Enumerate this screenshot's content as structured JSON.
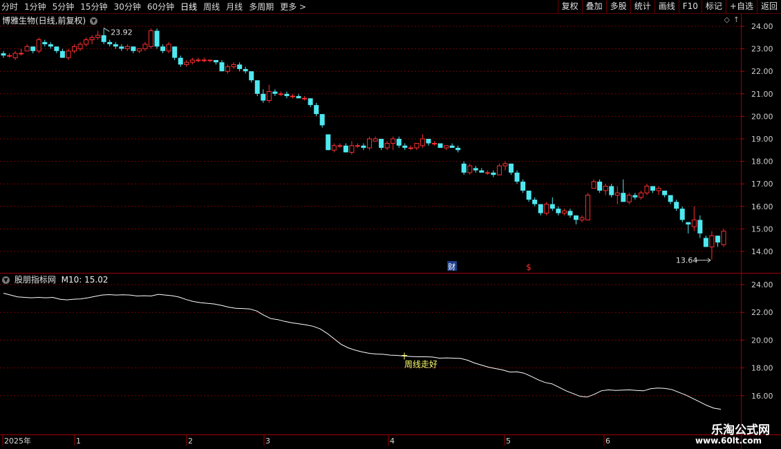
{
  "toolbar": {
    "periods": [
      "分时",
      "1分钟",
      "5分钟",
      "15分钟",
      "30分钟",
      "60分钟",
      "日线",
      "周线",
      "月线",
      "多周期",
      "更多 >"
    ],
    "active_period": "日线",
    "right_buttons": [
      "复权",
      "叠加",
      "多股",
      "统计",
      "画线",
      "F10",
      "标记",
      "+自选",
      "返回"
    ]
  },
  "main_panel": {
    "title": "博雅生物(日线,前复权)",
    "max_label": "23.92",
    "min_label": "13.64",
    "event_cai": "财",
    "event_dollar": "$"
  },
  "indicator_panel": {
    "name": "股朋指标网",
    "ma_label": "M10: 15.02",
    "annotation": "周线走好"
  },
  "x_axis": {
    "labels": [
      "2025年",
      "1",
      "2",
      "3",
      "4",
      "5",
      "6"
    ]
  },
  "watermark": {
    "line1": "乐淘公式网",
    "line2": "www.60lt.com"
  },
  "colors": {
    "up": "#ff3030",
    "down": "#4fe8f0",
    "grid": "#7a0000",
    "ma": "#ffffff",
    "annotation": "#ffff70"
  },
  "chart_data": [
    {
      "type": "candlestick",
      "title": "博雅生物(日线,前复权)",
      "ylim": [
        13.3,
        24.4
      ],
      "yticks": [
        14.0,
        15.0,
        16.0,
        17.0,
        18.0,
        19.0,
        20.0,
        21.0,
        22.0,
        23.0,
        24.0
      ],
      "candles": [
        [
          22.8,
          22.9,
          22.6,
          22.7
        ],
        [
          22.7,
          22.8,
          22.6,
          22.7
        ],
        [
          22.6,
          22.9,
          22.5,
          22.8
        ],
        [
          22.8,
          23.0,
          22.7,
          22.8
        ],
        [
          22.9,
          23.2,
          22.9,
          23.1
        ],
        [
          23.1,
          23.1,
          22.8,
          22.9
        ],
        [
          22.9,
          23.5,
          22.8,
          23.4
        ],
        [
          23.3,
          23.4,
          23.1,
          23.2
        ],
        [
          23.2,
          23.3,
          23.0,
          23.1
        ],
        [
          23.1,
          23.1,
          22.8,
          22.9
        ],
        [
          22.9,
          23.0,
          22.6,
          22.6
        ],
        [
          22.6,
          23.0,
          22.5,
          22.9
        ],
        [
          22.9,
          23.2,
          22.8,
          23.1
        ],
        [
          23.0,
          23.3,
          22.9,
          23.2
        ],
        [
          23.2,
          23.5,
          23.1,
          23.4
        ],
        [
          23.4,
          23.6,
          23.2,
          23.5
        ],
        [
          23.5,
          23.8,
          23.4,
          23.6
        ],
        [
          23.6,
          23.92,
          23.2,
          23.3
        ],
        [
          23.3,
          23.4,
          23.1,
          23.2
        ],
        [
          23.2,
          23.3,
          23.0,
          23.1
        ],
        [
          23.1,
          23.2,
          22.9,
          23.0
        ],
        [
          23.0,
          23.2,
          22.9,
          23.1
        ],
        [
          23.1,
          23.1,
          22.8,
          22.9
        ],
        [
          22.9,
          23.0,
          22.8,
          23.0
        ],
        [
          23.0,
          23.3,
          22.9,
          23.2
        ],
        [
          23.1,
          23.9,
          23.0,
          23.8
        ],
        [
          23.8,
          23.9,
          23.0,
          23.1
        ],
        [
          23.1,
          23.2,
          22.8,
          22.9
        ],
        [
          22.9,
          23.3,
          22.8,
          23.2
        ],
        [
          23.1,
          23.1,
          22.5,
          22.6
        ],
        [
          22.6,
          22.7,
          22.2,
          22.3
        ],
        [
          22.3,
          22.5,
          22.2,
          22.4
        ],
        [
          22.4,
          22.6,
          22.3,
          22.5
        ],
        [
          22.5,
          22.6,
          22.4,
          22.5
        ],
        [
          22.5,
          22.6,
          22.4,
          22.5
        ],
        [
          22.5,
          22.5,
          22.4,
          22.5
        ],
        [
          22.5,
          22.5,
          22.3,
          22.4
        ],
        [
          22.4,
          22.5,
          22.0,
          22.0
        ],
        [
          22.0,
          22.3,
          21.9,
          22.2
        ],
        [
          22.2,
          22.4,
          22.1,
          22.3
        ],
        [
          22.3,
          22.4,
          22.0,
          22.1
        ],
        [
          22.1,
          22.2,
          21.9,
          22.0
        ],
        [
          22.0,
          22.0,
          21.5,
          21.6
        ],
        [
          21.6,
          21.6,
          20.9,
          21.0
        ],
        [
          21.0,
          21.2,
          20.6,
          20.7
        ],
        [
          20.7,
          21.4,
          20.6,
          21.1
        ],
        [
          21.1,
          21.2,
          20.9,
          21.0
        ],
        [
          21.0,
          21.1,
          20.9,
          21.0
        ],
        [
          21.0,
          21.1,
          20.8,
          20.9
        ],
        [
          20.9,
          21.0,
          20.8,
          20.9
        ],
        [
          20.9,
          21.0,
          20.8,
          20.8
        ],
        [
          20.8,
          20.9,
          20.7,
          20.8
        ],
        [
          20.8,
          20.8,
          20.4,
          20.5
        ],
        [
          20.5,
          20.6,
          20.0,
          20.1
        ],
        [
          20.1,
          20.1,
          19.5,
          19.6
        ],
        [
          19.2,
          19.2,
          18.5,
          18.5
        ],
        [
          18.5,
          18.8,
          18.4,
          18.7
        ],
        [
          18.7,
          18.8,
          18.6,
          18.7
        ],
        [
          18.7,
          18.8,
          18.4,
          18.4
        ],
        [
          18.4,
          18.9,
          18.3,
          18.7
        ],
        [
          18.7,
          18.8,
          18.6,
          18.7
        ],
        [
          18.7,
          18.8,
          18.5,
          18.6
        ],
        [
          18.6,
          19.1,
          18.5,
          19.0
        ],
        [
          18.9,
          19.1,
          18.9,
          19.0
        ],
        [
          19.0,
          19.0,
          18.5,
          18.6
        ],
        [
          18.6,
          18.9,
          18.5,
          18.8
        ],
        [
          18.8,
          19.1,
          18.5,
          19.0
        ],
        [
          19.0,
          19.1,
          18.6,
          18.7
        ],
        [
          18.7,
          18.8,
          18.5,
          18.6
        ],
        [
          18.6,
          18.7,
          18.5,
          18.6
        ],
        [
          18.6,
          18.8,
          18.5,
          18.8
        ],
        [
          18.7,
          19.2,
          18.6,
          19.0
        ],
        [
          19.0,
          19.0,
          18.7,
          18.8
        ],
        [
          18.8,
          18.9,
          18.7,
          18.8
        ],
        [
          18.8,
          18.8,
          18.6,
          18.6
        ],
        [
          18.6,
          18.7,
          18.5,
          18.7
        ],
        [
          18.7,
          18.8,
          18.6,
          18.6
        ],
        [
          18.6,
          18.7,
          18.4,
          18.5
        ],
        [
          17.9,
          18.0,
          17.4,
          17.5
        ],
        [
          17.5,
          17.9,
          17.4,
          17.8
        ],
        [
          17.7,
          17.8,
          17.5,
          17.6
        ],
        [
          17.6,
          17.7,
          17.5,
          17.5
        ],
        [
          17.5,
          17.6,
          17.4,
          17.5
        ],
        [
          17.5,
          17.6,
          17.3,
          17.4
        ],
        [
          17.4,
          17.9,
          17.4,
          17.8
        ],
        [
          17.8,
          18.0,
          17.6,
          17.9
        ],
        [
          17.9,
          17.9,
          17.4,
          17.5
        ],
        [
          17.5,
          17.6,
          17.0,
          17.1
        ],
        [
          17.1,
          17.2,
          16.6,
          16.7
        ],
        [
          16.7,
          16.7,
          16.2,
          16.3
        ],
        [
          16.3,
          16.4,
          16.0,
          16.1
        ],
        [
          16.1,
          16.1,
          15.6,
          15.7
        ],
        [
          15.7,
          16.2,
          15.6,
          16.1
        ],
        [
          16.1,
          16.4,
          15.8,
          15.9
        ],
        [
          15.9,
          16.0,
          15.6,
          15.7
        ],
        [
          15.7,
          15.9,
          15.6,
          15.8
        ],
        [
          15.8,
          15.9,
          15.5,
          15.6
        ],
        [
          15.6,
          15.6,
          15.2,
          15.4
        ],
        [
          15.4,
          15.6,
          15.3,
          15.5
        ],
        [
          15.4,
          16.6,
          15.4,
          16.5
        ],
        [
          16.8,
          17.2,
          16.8,
          17.1
        ],
        [
          17.1,
          17.2,
          16.6,
          16.7
        ],
        [
          16.7,
          17.0,
          16.5,
          16.9
        ],
        [
          16.9,
          17.0,
          16.4,
          16.5
        ],
        [
          16.5,
          16.9,
          16.1,
          16.6
        ],
        [
          16.6,
          17.2,
          16.5,
          16.2
        ],
        [
          16.2,
          16.6,
          16.1,
          16.5
        ],
        [
          16.5,
          16.6,
          16.3,
          16.4
        ],
        [
          16.4,
          16.7,
          16.3,
          16.6
        ],
        [
          16.6,
          17.0,
          16.5,
          16.9
        ],
        [
          16.9,
          16.9,
          16.6,
          16.7
        ],
        [
          16.7,
          16.9,
          16.5,
          16.8
        ],
        [
          16.7,
          16.7,
          16.4,
          16.5
        ],
        [
          16.5,
          16.5,
          16.1,
          16.2
        ],
        [
          16.2,
          16.3,
          15.8,
          15.9
        ],
        [
          15.9,
          16.0,
          15.3,
          15.4
        ],
        [
          15.3,
          15.3,
          14.8,
          15.2
        ],
        [
          15.1,
          16.0,
          14.9,
          15.4
        ],
        [
          15.4,
          15.6,
          14.6,
          14.8
        ],
        [
          14.6,
          14.7,
          14.2,
          14.2
        ],
        [
          14.2,
          14.9,
          13.64,
          14.7
        ],
        [
          14.7,
          14.7,
          14.2,
          14.4
        ],
        [
          14.3,
          15.0,
          14.2,
          14.9
        ]
      ],
      "events": [
        {
          "index": 76,
          "label": "财"
        },
        {
          "index": 89,
          "label": "$"
        }
      ]
    },
    {
      "type": "line",
      "ylim": [
        14.5,
        25.0
      ],
      "yticks": [
        16.0,
        18.0,
        20.0,
        22.0,
        24.0
      ],
      "values": [
        23.38,
        23.25,
        23.12,
        23.08,
        23.05,
        23.08,
        23.05,
        23.08,
        22.95,
        22.9,
        22.95,
        22.97,
        23.05,
        23.15,
        23.25,
        23.28,
        23.25,
        23.27,
        23.25,
        23.18,
        23.2,
        23.18,
        23.3,
        23.25,
        23.2,
        23.1,
        22.92,
        22.78,
        22.7,
        22.65,
        22.6,
        22.5,
        22.38,
        22.3,
        22.28,
        22.25,
        22.1,
        21.8,
        21.55,
        21.48,
        21.35,
        21.25,
        21.18,
        21.1,
        21.0,
        20.82,
        20.5,
        20.1,
        19.7,
        19.45,
        19.28,
        19.15,
        19.05,
        19.0,
        18.98,
        18.92,
        18.9,
        18.85,
        18.82,
        18.8,
        18.8,
        18.78,
        18.7,
        18.72,
        18.7,
        18.68,
        18.55,
        18.35,
        18.2,
        18.05,
        17.95,
        17.85,
        17.7,
        17.72,
        17.62,
        17.4,
        17.15,
        16.95,
        16.85,
        16.6,
        16.35,
        16.15,
        15.95,
        15.9,
        16.1,
        16.35,
        16.42,
        16.38,
        16.4,
        16.42,
        16.38,
        16.35,
        16.5,
        16.55,
        16.52,
        16.45,
        16.25,
        16.05,
        15.8,
        15.55,
        15.3,
        15.1,
        15.02
      ],
      "annotation": {
        "text": "周线走好",
        "index": 57
      }
    }
  ]
}
